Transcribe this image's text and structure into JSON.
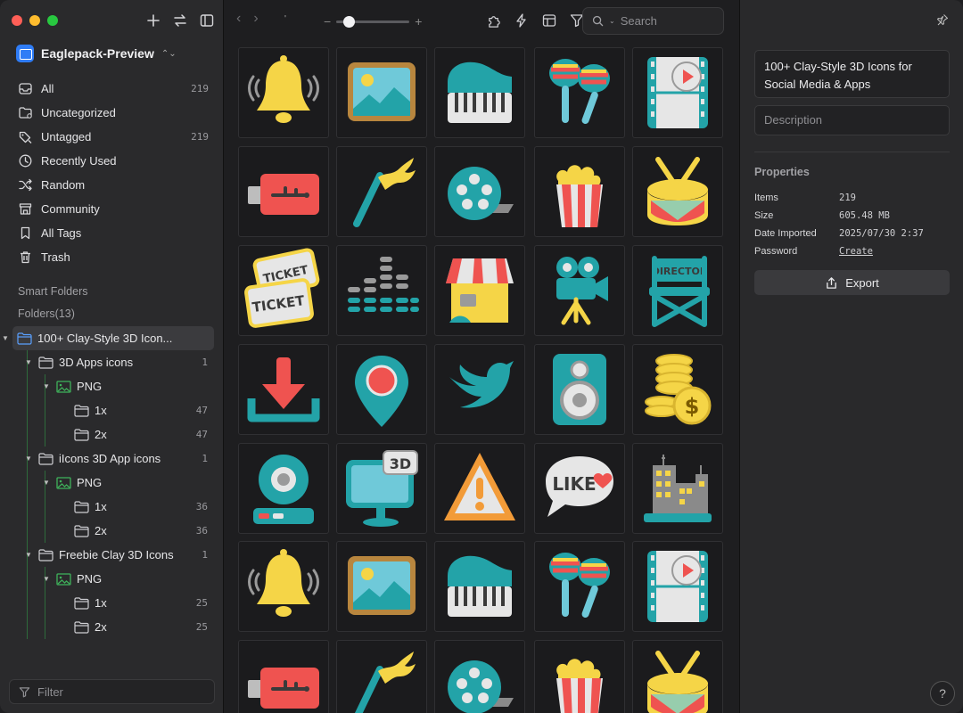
{
  "library": {
    "name": "Eaglepack-Preview"
  },
  "nav": [
    {
      "label": "All",
      "count": "219",
      "icon": "inbox-icon"
    },
    {
      "label": "Uncategorized",
      "count": "",
      "icon": "folder-question-icon"
    },
    {
      "label": "Untagged",
      "count": "219",
      "icon": "tag-off-icon"
    },
    {
      "label": "Recently Used",
      "count": "",
      "icon": "clock-icon"
    },
    {
      "label": "Random",
      "count": "",
      "icon": "shuffle-icon"
    },
    {
      "label": "Community",
      "count": "",
      "icon": "community-icon"
    },
    {
      "label": "All Tags",
      "count": "",
      "icon": "bookmark-icon"
    },
    {
      "label": "Trash",
      "count": "",
      "icon": "trash-icon"
    }
  ],
  "sections": {
    "smart_folders": "Smart Folders",
    "folders": "Folders(13)"
  },
  "tree": [
    {
      "label": "100+ Clay-Style 3D Icon...",
      "count": "",
      "level": 0,
      "type": "folder",
      "selected": true
    },
    {
      "label": "3D Apps icons",
      "count": "1",
      "level": 1,
      "type": "folder"
    },
    {
      "label": "PNG",
      "count": "",
      "level": 2,
      "type": "image"
    },
    {
      "label": "1x",
      "count": "47",
      "level": 3,
      "type": "folder"
    },
    {
      "label": "2x",
      "count": "47",
      "level": 3,
      "type": "folder"
    },
    {
      "label": "iIcons 3D App icons",
      "count": "1",
      "level": 1,
      "type": "folder"
    },
    {
      "label": "PNG",
      "count": "",
      "level": 2,
      "type": "image"
    },
    {
      "label": "1x",
      "count": "36",
      "level": 3,
      "type": "folder"
    },
    {
      "label": "2x",
      "count": "36",
      "level": 3,
      "type": "folder"
    },
    {
      "label": "Freebie Clay 3D Icons",
      "count": "1",
      "level": 1,
      "type": "folder"
    },
    {
      "label": "PNG",
      "count": "",
      "level": 2,
      "type": "image"
    },
    {
      "label": "1x",
      "count": "25",
      "level": 3,
      "type": "folder"
    },
    {
      "label": "2x",
      "count": "25",
      "level": 3,
      "type": "folder"
    }
  ],
  "filter": {
    "placeholder": "Filter"
  },
  "toolbar": {
    "search_placeholder": "Search",
    "tick": "'",
    "zoom_level": 0.12
  },
  "grid": {
    "items": [
      "bell-icon",
      "picture-icon",
      "piano-icon",
      "maracas-icon",
      "film-icon",
      "usb-icon",
      "flag-icon",
      "film-reel-icon",
      "popcorn-icon",
      "drum-icon",
      "tickets-icon",
      "equalizer-icon",
      "shop-icon",
      "movie-camera-icon",
      "director-chair-icon",
      "download-icon",
      "map-pin-icon",
      "bird-icon",
      "speaker-icon",
      "coins-icon",
      "webcam-icon",
      "3d-monitor-icon",
      "warning-icon",
      "like-bubble-icon",
      "city-icon",
      "bell-icon",
      "picture-icon",
      "piano-icon",
      "maracas-icon",
      "film-icon",
      "usb-icon",
      "flag-icon",
      "film-reel-icon",
      "popcorn-icon",
      "drum-icon"
    ],
    "texts": {
      "ticket": "TICKET",
      "director": "DIRECTOR",
      "three_d": "3D",
      "like": "LIKE",
      "dollar": "$"
    }
  },
  "inspector": {
    "title": "100+ Clay-Style 3D Icons for Social Media & Apps",
    "description_placeholder": "Description",
    "properties_title": "Properties",
    "properties": [
      {
        "key": "Items",
        "value": "219"
      },
      {
        "key": "Size",
        "value": "605.48 MB"
      },
      {
        "key": "Date Imported",
        "value": "2025/07/30 2:37"
      },
      {
        "key": "Password",
        "value": "Create"
      }
    ],
    "export_label": "Export",
    "help": "?"
  },
  "colors": {
    "accent": "#2f7cf6",
    "tree_image_icon": "#3fb35b",
    "clay_yellow": "#f5d547",
    "clay_teal": "#23a3a8",
    "clay_red": "#ef5350"
  }
}
